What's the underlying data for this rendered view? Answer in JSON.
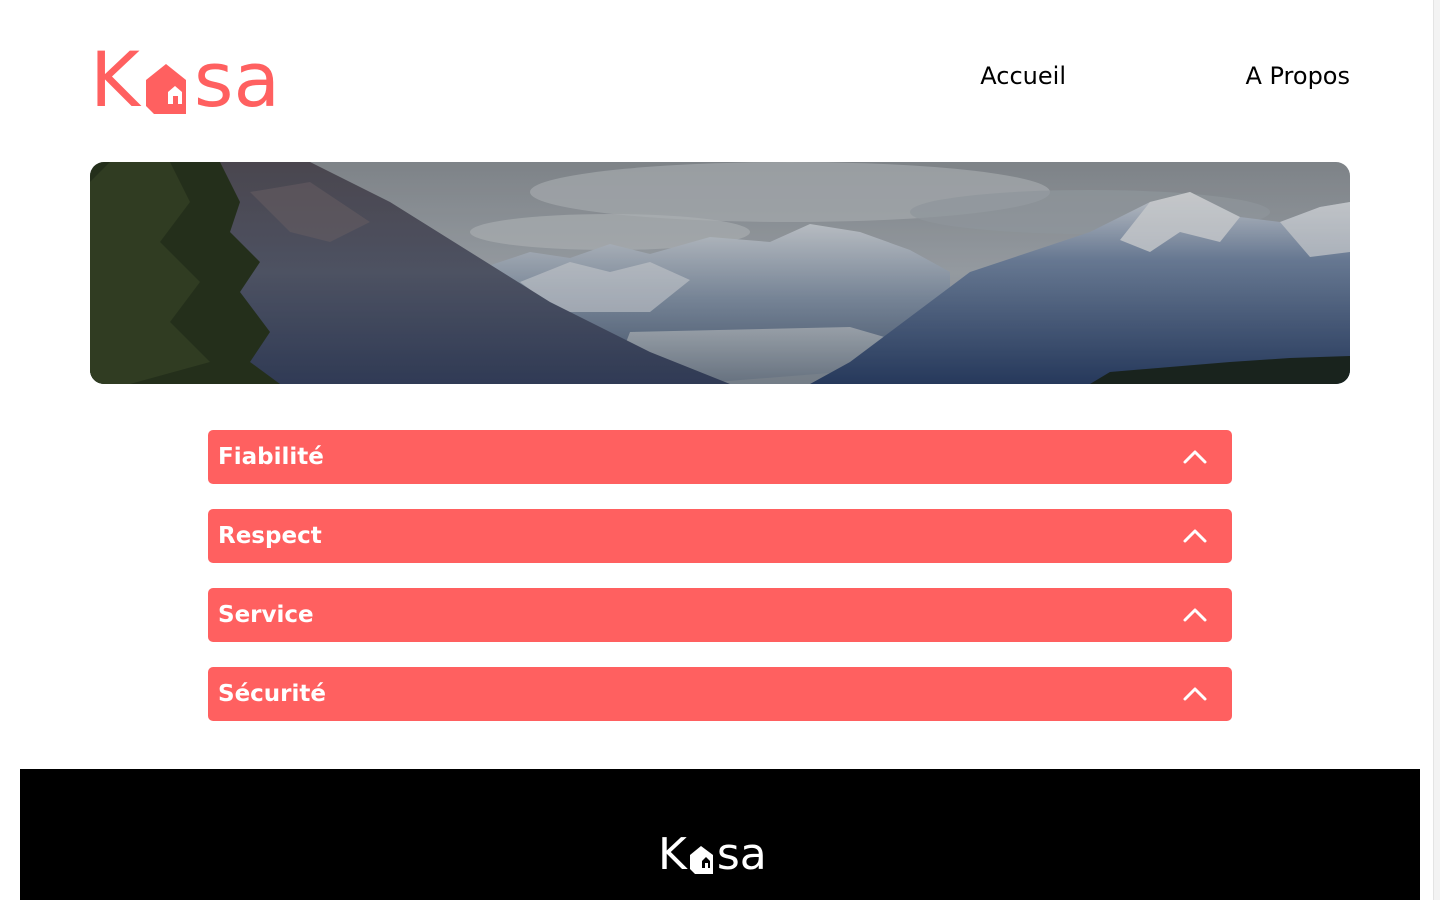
{
  "brand": {
    "logo_k": "K",
    "logo_sa": "sa",
    "accent_color": "#ff6060"
  },
  "nav": {
    "home_label": "Accueil",
    "about_label": "A Propos"
  },
  "banner": {
    "image_subject": "mountain-landscape"
  },
  "collapses": [
    {
      "title": "Fiabilité",
      "icon": "chevron-up-icon"
    },
    {
      "title": "Respect",
      "icon": "chevron-up-icon"
    },
    {
      "title": "Service",
      "icon": "chevron-up-icon"
    },
    {
      "title": "Sécurité",
      "icon": "chevron-up-icon"
    }
  ],
  "footer": {
    "logo_k": "K",
    "logo_sa": "sa",
    "background": "#000000"
  }
}
